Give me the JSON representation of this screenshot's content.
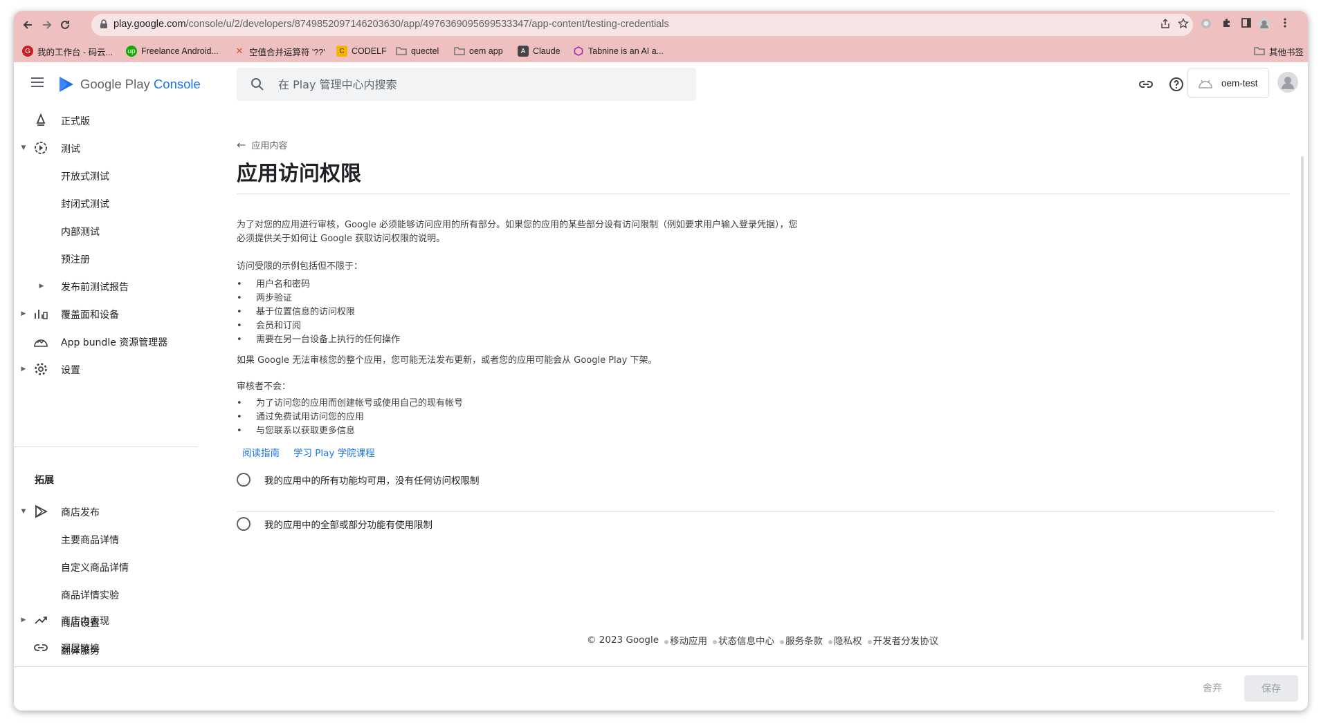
{
  "browser": {
    "url_host": "play.google.com",
    "url_path": "/console/u/2/developers/8749852097146203630/app/4976369095699533347/app-content/testing-credentials",
    "bookmarks": [
      {
        "label": "我的工作台 - 码云...",
        "color": "#c71d23"
      },
      {
        "label": "Freelance Android...",
        "color": "#14a800"
      },
      {
        "label": "空值合并运算符 '??'",
        "color": "#e34c26"
      },
      {
        "label": "CODELF",
        "color": "#f4b400"
      },
      {
        "label": "quectel",
        "color": "#5f6368"
      },
      {
        "label": "oem app",
        "color": "#5f6368"
      },
      {
        "label": "Claude",
        "color": "#444444"
      },
      {
        "label": "Tabnine is an AI a...",
        "color": "#9c27b0"
      }
    ],
    "other_bookmarks": "其他书签"
  },
  "header": {
    "logo_text_1": "Google Play ",
    "logo_text_2": "Console",
    "search_placeholder": "在 Play 管理中心内搜索",
    "account_name": "oem-test"
  },
  "sidebar": {
    "items": [
      {
        "label": "正式版",
        "icon": "release-icon"
      },
      {
        "label": "测试",
        "icon": "testing-icon"
      },
      {
        "label": "开放式测试"
      },
      {
        "label": "封闭式测试"
      },
      {
        "label": "内部测试"
      },
      {
        "label": "预注册"
      },
      {
        "label": "发布前测试报告"
      },
      {
        "label": "覆盖面和设备",
        "icon": "reach-icon"
      },
      {
        "label": "App bundle 资源管理器",
        "icon": "bundle-icon"
      },
      {
        "label": "设置",
        "icon": "gear-icon"
      }
    ],
    "section_title": "拓展",
    "ext_items": [
      {
        "label": "商店发布",
        "icon": "play-icon"
      },
      {
        "label": "主要商品详情"
      },
      {
        "label": "自定义商品详情"
      },
      {
        "label": "商品详情实验"
      },
      {
        "label": "商店设置"
      },
      {
        "label": "翻译服务"
      },
      {
        "label": "商店内表现",
        "icon": "trend-icon"
      },
      {
        "label": "深层链接",
        "icon": "link-icon"
      }
    ]
  },
  "main": {
    "back_label": "应用内容",
    "title": "应用访问权限",
    "intro_1": "为了对您的应用进行审核，Google 必须能够访问应用的所有部分。如果您的应用的某些部分设有访问限制（例如要求用户输入登录凭据），您",
    "intro_2": "必须提供关于如何让 Google 获取访问权限的说明。",
    "examples_title": "访问受限的示例包括但不限于：",
    "examples": [
      "用户名和密码",
      "两步验证",
      "基于位置信息的访问权限",
      "会员和订阅",
      "需要在另一台设备上执行的任何操作"
    ],
    "warning": "如果 Google 无法审核您的整个应用，您可能无法发布更新，或者您的应用可能会从 Google Play 下架。",
    "reviewers_title": "审核者不会：",
    "reviewers": [
      "为了访问您的应用而创建帐号或使用自己的现有帐号",
      "通过免费试用访问您的应用",
      "与您联系以获取更多信息"
    ],
    "link_guide": "阅读指南",
    "link_course": "学习 Play 学院课程",
    "option_all": "我的应用中的所有功能均可用，没有任何访问权限制",
    "option_restricted": "我的应用中的全部或部分功能有使用限制"
  },
  "footer": {
    "copyright": "© 2023 Google",
    "links": [
      "移动应用",
      "状态信息中心",
      "服务条款",
      "隐私权",
      "开发者分发协议"
    ]
  },
  "actions": {
    "discard": "舍弃",
    "save": "保存"
  }
}
